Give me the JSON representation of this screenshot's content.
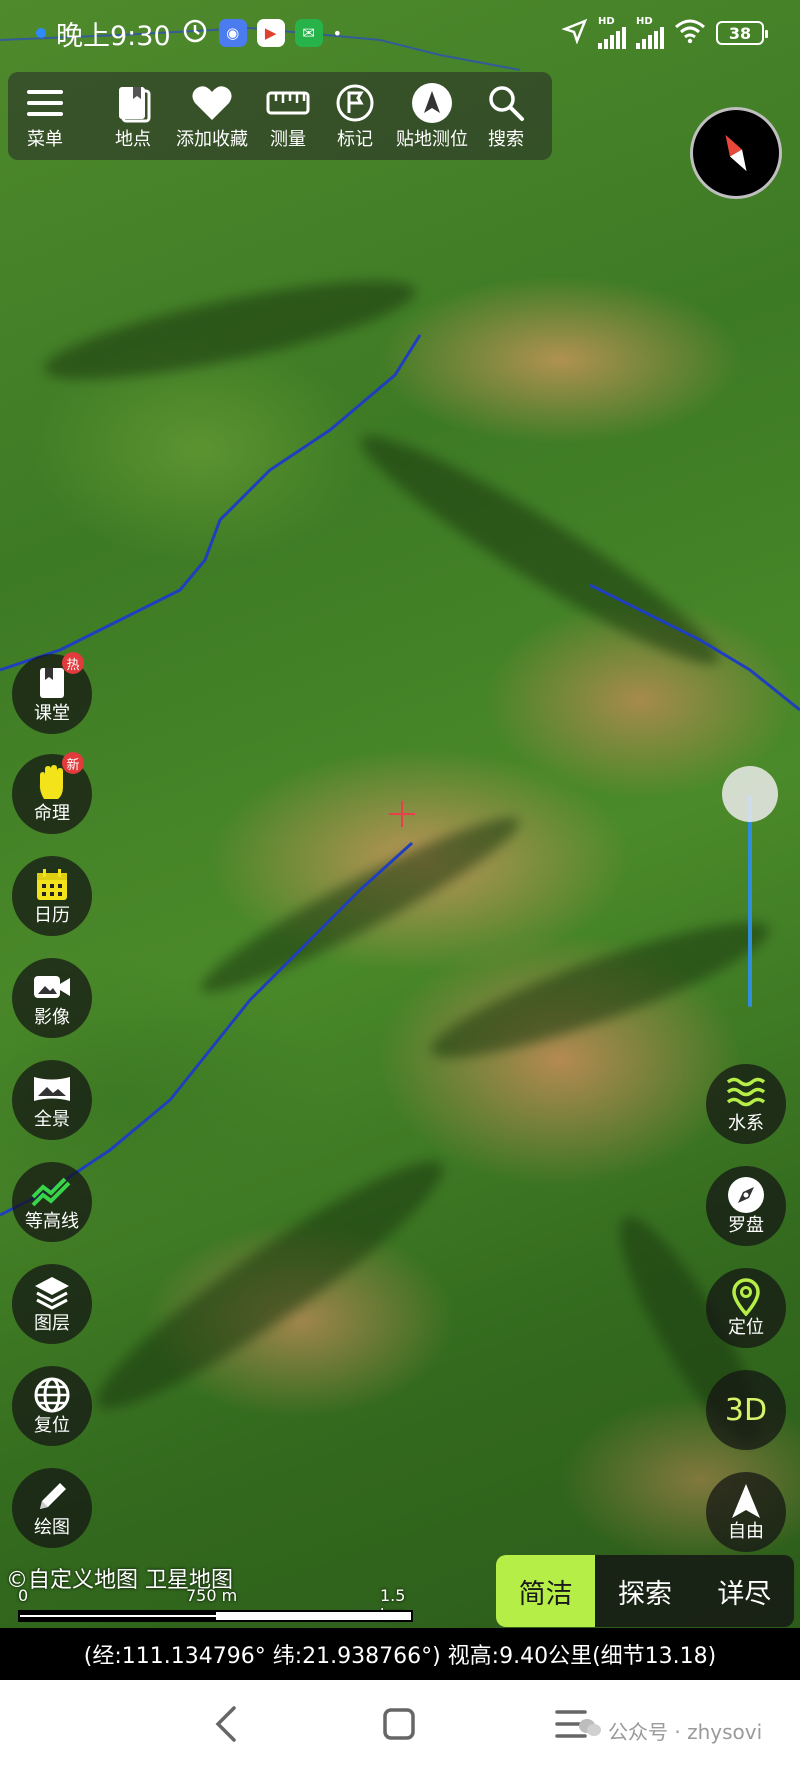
{
  "status_bar": {
    "time": "晚上9:30",
    "battery": "38",
    "network_badges": [
      "HD",
      "HD"
    ]
  },
  "toolbar": {
    "menu": "菜单",
    "places": "地点",
    "favorite": "添加收藏",
    "measure": "测量",
    "mark": "标记",
    "locate_ground": "贴地测位",
    "search": "搜索"
  },
  "left_buttons": {
    "classroom": "课堂",
    "classroom_badge": "热",
    "fortune": "命理",
    "fortune_badge": "新",
    "calendar": "日历",
    "video": "影像",
    "panorama": "全景",
    "contour": "等高线",
    "layers": "图层",
    "reset": "复位",
    "draw": "绘图"
  },
  "right_buttons": {
    "water": "水系",
    "compass": "罗盘",
    "locate": "定位",
    "three_d": "3D",
    "free": "自由"
  },
  "attribution": "©自定义地图 卫星地图",
  "scale": {
    "zero": "0",
    "mid": "750 m",
    "max": "1.5 km"
  },
  "mode_tabs": [
    "简洁",
    "探索",
    "详尽"
  ],
  "active_mode": "简洁",
  "coordinates": "(经:111.134796° 纬:21.938766°) 视高:9.40公里(细节13.18)",
  "watermark": "公众号 · zhysovi",
  "colors": {
    "accent": "#b6ee48",
    "river": "#1f3fbf",
    "badge": "#e23b3b",
    "slider": "#2f8ee0"
  }
}
